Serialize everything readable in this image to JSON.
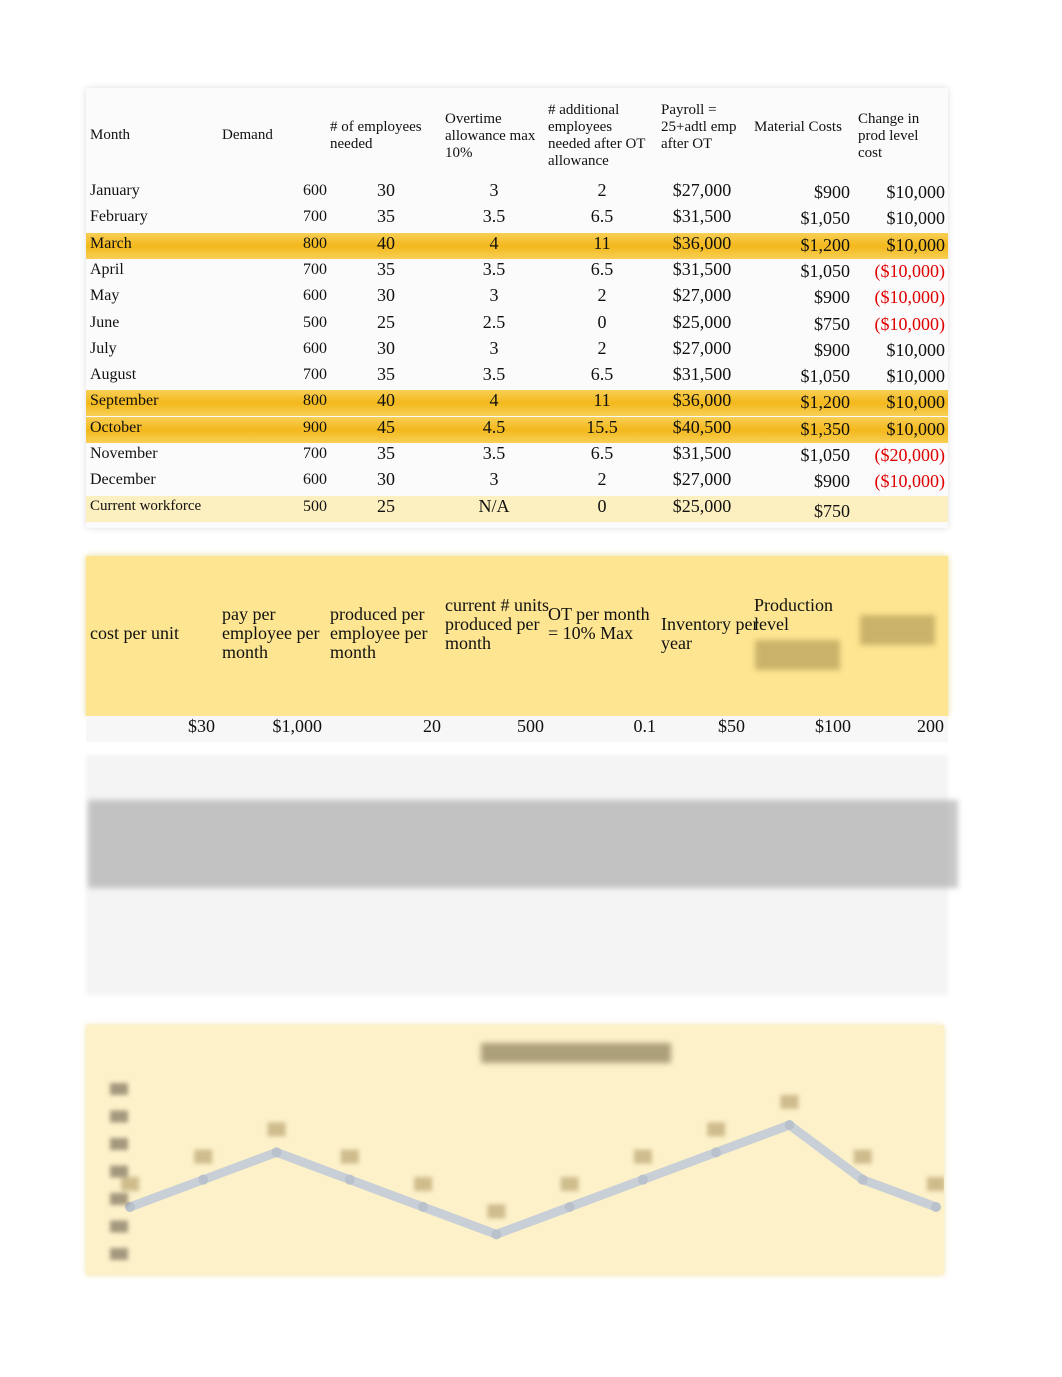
{
  "table1": {
    "headers": [
      "Month",
      "Demand",
      "# of employees needed",
      "Overtime allowance max 10%",
      "# additional employees needed after OT allowance",
      "Payroll = 25+adtl emp after OT",
      "Material Costs",
      "Change in prod level cost"
    ],
    "rows": [
      {
        "month": "January",
        "demand": "600",
        "emp": "30",
        "ot": "3",
        "add": "2",
        "payroll": "$27,000",
        "material": "$900",
        "change": "$10,000",
        "neg": false,
        "highlight": false
      },
      {
        "month": "February",
        "demand": "700",
        "emp": "35",
        "ot": "3.5",
        "add": "6.5",
        "payroll": "$31,500",
        "material": "$1,050",
        "change": "$10,000",
        "neg": false,
        "highlight": false
      },
      {
        "month": "March",
        "demand": "800",
        "emp": "40",
        "ot": "4",
        "add": "11",
        "payroll": "$36,000",
        "material": "$1,200",
        "change": "$10,000",
        "neg": false,
        "highlight": true
      },
      {
        "month": "April",
        "demand": "700",
        "emp": "35",
        "ot": "3.5",
        "add": "6.5",
        "payroll": "$31,500",
        "material": "$1,050",
        "change": "($10,000)",
        "neg": true,
        "highlight": false
      },
      {
        "month": "May",
        "demand": "600",
        "emp": "30",
        "ot": "3",
        "add": "2",
        "payroll": "$27,000",
        "material": "$900",
        "change": "($10,000)",
        "neg": true,
        "highlight": false
      },
      {
        "month": "June",
        "demand": "500",
        "emp": "25",
        "ot": "2.5",
        "add": "0",
        "payroll": "$25,000",
        "material": "$750",
        "change": "($10,000)",
        "neg": true,
        "highlight": false
      },
      {
        "month": "July",
        "demand": "600",
        "emp": "30",
        "ot": "3",
        "add": "2",
        "payroll": "$27,000",
        "material": "$900",
        "change": "$10,000",
        "neg": false,
        "highlight": false
      },
      {
        "month": "August",
        "demand": "700",
        "emp": "35",
        "ot": "3.5",
        "add": "6.5",
        "payroll": "$31,500",
        "material": "$1,050",
        "change": "$10,000",
        "neg": false,
        "highlight": false
      },
      {
        "month": "September",
        "demand": "800",
        "emp": "40",
        "ot": "4",
        "add": "11",
        "payroll": "$36,000",
        "material": "$1,200",
        "change": "$10,000",
        "neg": false,
        "highlight": true
      },
      {
        "month": "October",
        "demand": "900",
        "emp": "45",
        "ot": "4.5",
        "add": "15.5",
        "payroll": "$40,500",
        "material": "$1,350",
        "change": "$10,000",
        "neg": false,
        "highlight": true
      },
      {
        "month": "November",
        "demand": "700",
        "emp": "35",
        "ot": "3.5",
        "add": "6.5",
        "payroll": "$31,500",
        "material": "$1,050",
        "change": "($20,000)",
        "neg": true,
        "highlight": false
      },
      {
        "month": "December",
        "demand": "600",
        "emp": "30",
        "ot": "3",
        "add": "2",
        "payroll": "$27,000",
        "material": "$900",
        "change": "($10,000)",
        "neg": true,
        "highlight": false
      },
      {
        "month": "Current workforce",
        "demand": "500",
        "emp": "25",
        "ot": "N/A",
        "add": "0",
        "payroll": "$25,000",
        "material": "$750",
        "change": "",
        "neg": false,
        "highlight": false
      }
    ]
  },
  "table2": {
    "headers": [
      "cost per unit",
      "pay per employee per month",
      "produced per employee per month",
      "current # units produced per month",
      "OT per month = 10% Max",
      "Inventory per year",
      "Production level",
      ""
    ],
    "values": [
      "$30",
      "$1,000",
      "20",
      "500",
      "0.1",
      "$50",
      "$100",
      "200"
    ]
  },
  "colors": {
    "highlight": "#f5bf2a",
    "header_yellow": "#fde591",
    "negative": "#e00000",
    "chart_bg": "#fdf1c9",
    "line": "#c9cfd6"
  },
  "chart_data": {
    "type": "line",
    "categories": [
      "January",
      "February",
      "March",
      "April",
      "May",
      "June",
      "July",
      "August",
      "September",
      "October",
      "November",
      "December"
    ],
    "values": [
      600,
      700,
      800,
      700,
      600,
      500,
      600,
      700,
      800,
      900,
      700,
      600
    ],
    "title": "",
    "xlabel": "",
    "ylabel": ""
  }
}
